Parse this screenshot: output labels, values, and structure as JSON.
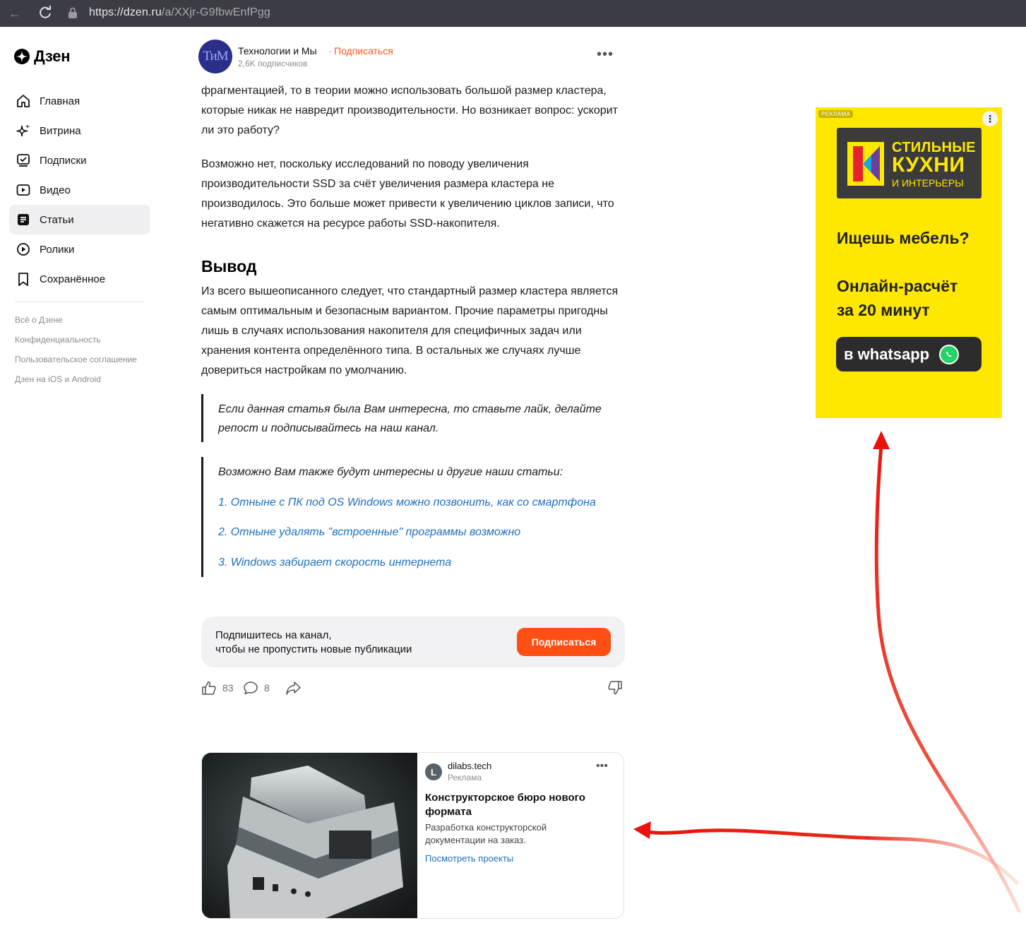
{
  "browser": {
    "url_host": "https://dzen.ru",
    "url_path": "/a/XXjr-G9fbwEnfPgg"
  },
  "sidebar": {
    "logo_text": "Дзен",
    "items": [
      {
        "label": "Главная",
        "icon": "home-icon"
      },
      {
        "label": "Витрина",
        "icon": "sparkle-icon"
      },
      {
        "label": "Подписки",
        "icon": "subscriptions-icon"
      },
      {
        "label": "Видео",
        "icon": "video-icon"
      },
      {
        "label": "Статьи",
        "icon": "article-icon",
        "active": true
      },
      {
        "label": "Ролики",
        "icon": "clips-icon"
      },
      {
        "label": "Сохранённое",
        "icon": "bookmark-icon"
      }
    ],
    "footer_links": [
      "Всё о Дзене",
      "Конфиденциальность",
      "Пользовательское соглашение",
      "Дзен на iOS и Android"
    ]
  },
  "channel": {
    "avatar_text": "ТиМ",
    "name": "Технологии и Мы",
    "separator": "·",
    "subscribe_label": "Подписаться",
    "subscribers": "2,6K подписчиков",
    "more": "•••"
  },
  "article": {
    "p1": "фрагментацией, то в теории можно использовать большой размер кластера, которые никак не навредит производительности. Но возникает вопрос: ускорит ли это работу?",
    "p2": "Возможно нет, поскольку исследований по поводу увеличения производительности SSD за счёт увеличения размера кластера не производилось. Это больше может привести к увеличению циклов записи, что негативно скажется на ресурсе работы SSD-накопителя.",
    "heading": "Вывод",
    "p3": "Из всего вышеописанного следует, что стандартный размер кластера является самым оптимальным и безопасным вариантом. Прочие параметры пригодны лишь в случаях использования накопителя для специфичных задач или хранения контента определённого типа. В остальных же случаях лучше довериться настройкам по умолчанию.",
    "quote1": "Если данная статья была Вам интересна, то ставьте лайк, делайте репост и подписывайтесь на наш канал.",
    "quote2_intro": "Возможно Вам также будут интересны и другие наши статьи:",
    "links": [
      "1. Отныне с ПК под OS Windows можно позвонить, как со смартфона",
      "2. Отныне удалять \"встроенные\" программы возможно",
      "3. Windows забирает скорость интернета"
    ]
  },
  "subscribe_box": {
    "line1": "Подпишитесь на канал,",
    "line2": "чтобы не пропустить новые публикации",
    "button": "Подписаться"
  },
  "actions": {
    "likes": "83",
    "comments": "8"
  },
  "native_ad": {
    "logo_letter": "L",
    "domain": "dilabs.tech",
    "label": "Реклама",
    "title": "Конструкторское бюро нового формата",
    "description": "Разработка конструкторской документации на заказ.",
    "link": "Посмотреть проекты",
    "more": "•••"
  },
  "banner_ad": {
    "tag": "РЕКЛАМА",
    "menu": "⋮",
    "brand_line1": "СТИЛЬНЫЕ",
    "brand_line2": "КУХНИ",
    "brand_line3": "И ИНТЕРЬЕРЫ",
    "question": "Ищешь мебель?",
    "offer_line1": "Онлайн-расчёт",
    "offer_line2": "за 20 минут",
    "button": "в whatsapp",
    "bg_color": "#ffe800"
  },
  "colors": {
    "accent": "#ff4f12",
    "link": "#1d6fbe",
    "annotation_arrow": "#e8140c"
  }
}
